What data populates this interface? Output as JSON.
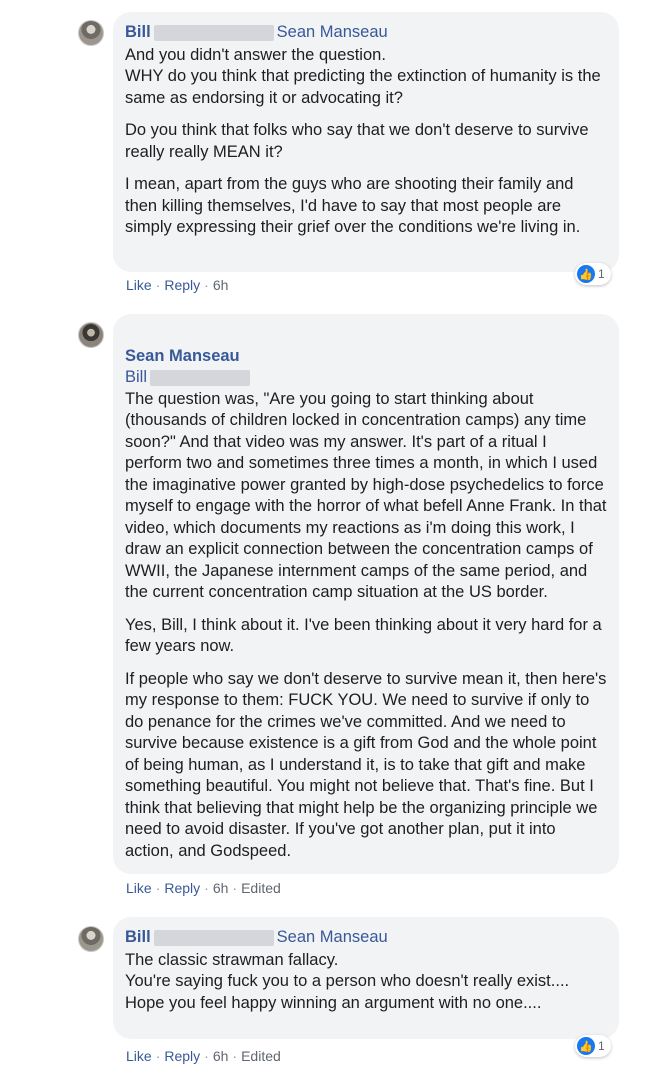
{
  "comments": [
    {
      "author": "Bill",
      "reply_to": "Sean Manseau",
      "paragraphs": [
        "And you didn't answer the question.\nWHY do you think that predicting the extinction of humanity is the same as endorsing it or advocating it?",
        "Do you think that folks who say that we don't deserve to survive really really MEAN it?",
        "I mean, apart from the guys who are shooting their family and then killing themselves, I'd have to say that most people are simply expressing their grief over the conditions we're living in."
      ],
      "actions": {
        "like": "Like",
        "reply": "Reply",
        "time": "6h"
      },
      "reaction_count": "1"
    },
    {
      "author": "Sean Manseau",
      "reply_to": "Bill",
      "paragraphs": [
        "The question was, \"Are you going to start thinking about (thousands of children locked in concentration camps) any time soon?\" And that video was my answer. It's part of a ritual I perform two and sometimes three times a month, in which I used the imaginative power granted by high-dose psychedelics to force myself to engage with the horror of what befell Anne Frank. In that video, which documents my reactions as i'm doing this work, I draw an explicit connection between the concentration camps of WWII, the Japanese internment camps of the same period, and the current concentration camp situation at the US border.",
        "Yes, Bill, I think about it. I've been thinking about it very hard for a few years now.",
        "If people who say we don't deserve to survive mean it, then here's my response to them: FUCK YOU. We need to survive if only to do penance for the crimes we've committed. And we need to survive because existence is a gift from God and the whole point of being human, as I understand it, is to take that gift and make something beautiful. You might not believe that. That's fine. But I think that believing that might help be the organizing principle we need to avoid disaster. If you've got another plan, put it into action, and Godspeed."
      ],
      "actions": {
        "like": "Like",
        "reply": "Reply",
        "time": "6h",
        "edited": "Edited"
      }
    },
    {
      "author": "Bill",
      "reply_to": "Sean Manseau",
      "paragraphs": [
        "The classic strawman fallacy.\nYou're saying fuck you to a person who doesn't really exist....\nHope you feel happy winning an argument with no one...."
      ],
      "actions": {
        "like": "Like",
        "reply": "Reply",
        "time": "6h",
        "edited": "Edited"
      },
      "reaction_count": "1"
    }
  ],
  "colors": {
    "bubble": "#f2f3f5",
    "link": "#385898",
    "like": "#1877f2"
  },
  "icons": {
    "reaction": "thumbs-up-icon"
  }
}
